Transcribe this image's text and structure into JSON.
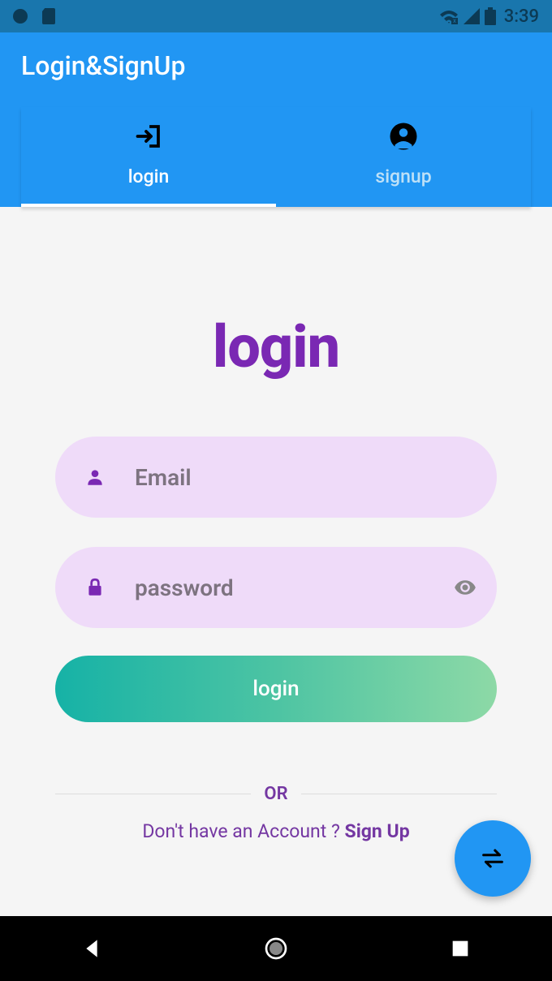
{
  "status": {
    "time": "3:39"
  },
  "appBar": {
    "title": "Login&SignUp"
  },
  "tabs": {
    "login": "login",
    "signup": "signup"
  },
  "main": {
    "heading": "login",
    "emailPlaceholder": "Email",
    "passwordPlaceholder": "password",
    "loginButton": "login",
    "dividerText": "OR",
    "promptText": "Don't have an Account ? ",
    "signupLink": "Sign Up"
  }
}
